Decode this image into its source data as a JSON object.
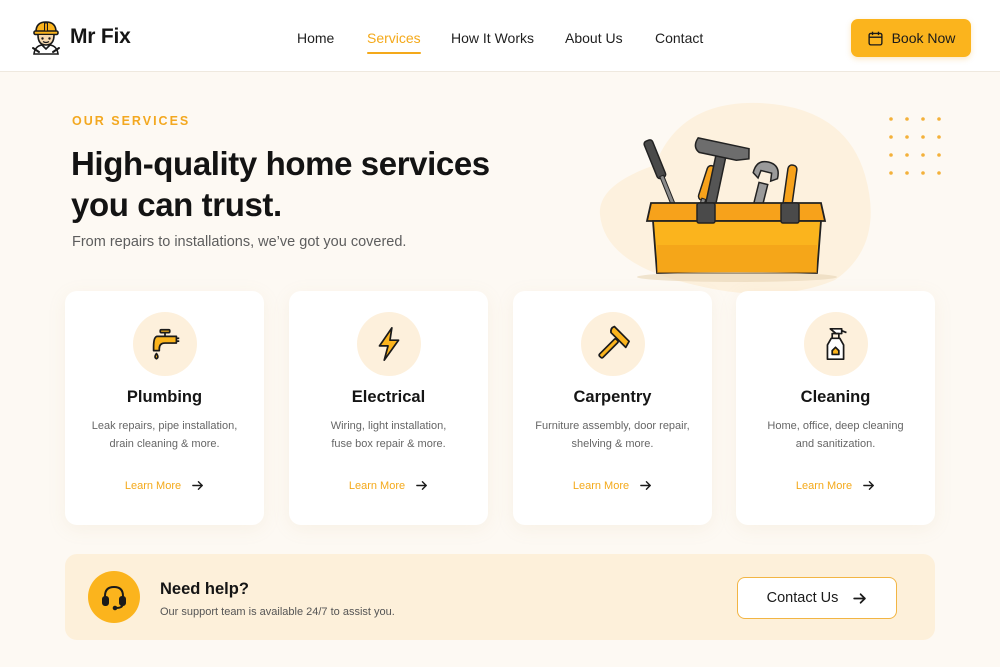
{
  "brand": {
    "name": "Mr Fix",
    "logo_icon": "handyman-logo-icon"
  },
  "nav": {
    "items": [
      {
        "label": "Home",
        "active": false
      },
      {
        "label": "Services",
        "active": true
      },
      {
        "label": "How It Works",
        "active": false
      },
      {
        "label": "About Us",
        "active": false
      },
      {
        "label": "Contact",
        "active": false
      }
    ],
    "book_button": {
      "label": "Book Now",
      "icon": "calendar-icon"
    }
  },
  "hero": {
    "eyebrow": "OUR SERVICES",
    "title_line1": "High-quality home services",
    "title_line2": "you can trust.",
    "subtitle": "From repairs to installations, we’ve got you covered.",
    "illustration": "toolbox-illustration"
  },
  "services": [
    {
      "title": "Plumbing",
      "desc_line1": "Leak repairs, pipe installation,",
      "desc_line2": "drain cleaning & more.",
      "link": "Learn More",
      "icon": "faucet-icon"
    },
    {
      "title": "Electrical",
      "desc_line1": "Wiring, light installation,",
      "desc_line2": "fuse box repair & more.",
      "link": "Learn More",
      "icon": "lightning-icon"
    },
    {
      "title": "Carpentry",
      "desc_line1": "Furniture assembly, door repair,",
      "desc_line2": "shelving & more.",
      "link": "Learn More",
      "icon": "hammer-icon"
    },
    {
      "title": "Cleaning",
      "desc_line1": "Home, office, deep cleaning",
      "desc_line2": "and sanitization.",
      "link": "Learn More",
      "icon": "spray-bottle-icon"
    }
  ],
  "help": {
    "title": "Need help?",
    "subtitle": "Our support team is available 24/7 to assist you.",
    "button": "Contact Us",
    "icon": "headset-icon"
  },
  "colors": {
    "accent": "#fbb41d",
    "accent_text": "#f4a91a",
    "page_background": "#fdf9f3",
    "help_background": "#fdf0da"
  }
}
